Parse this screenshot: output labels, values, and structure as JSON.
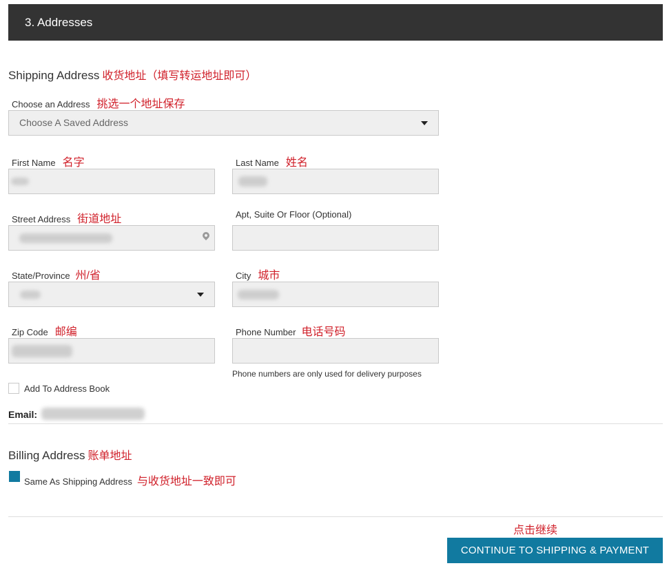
{
  "header": {
    "step_title": "3. Addresses"
  },
  "shipping": {
    "title": "Shipping Address",
    "title_note": "收货地址（填写转运地址即可）",
    "choose_label": "Choose an Address",
    "choose_note": "挑选一个地址保存",
    "choose_value": "Choose A Saved Address",
    "first_name_label": "First Name",
    "first_name_note": "名字",
    "last_name_label": "Last Name",
    "last_name_note": "姓名",
    "street_label": "Street Address",
    "street_note": "街道地址",
    "apt_label": "Apt, Suite Or Floor (Optional)",
    "state_label": "State/Province",
    "state_note": "州/省",
    "city_label": "City",
    "city_note": "城市",
    "zip_label": "Zip Code",
    "zip_note": "邮编",
    "phone_label": "Phone Number",
    "phone_note": "电话号码",
    "phone_help": "Phone numbers are only used for delivery purposes",
    "add_book_label": "Add To Address Book",
    "add_book_checked": false,
    "email_label": "Email:"
  },
  "billing": {
    "title": "Billing Address",
    "title_note": "账单地址",
    "same_label": "Same As Shipping Address",
    "same_note": "与收货地址一致即可",
    "same_checked": true
  },
  "footer": {
    "continue_note": "点击继续",
    "continue_label": "CONTINUE TO SHIPPING & PAYMENT"
  },
  "colors": {
    "header_bg": "#333333",
    "accent": "#117aa0",
    "annotation": "#d0202a",
    "field_bg": "#efefef"
  }
}
